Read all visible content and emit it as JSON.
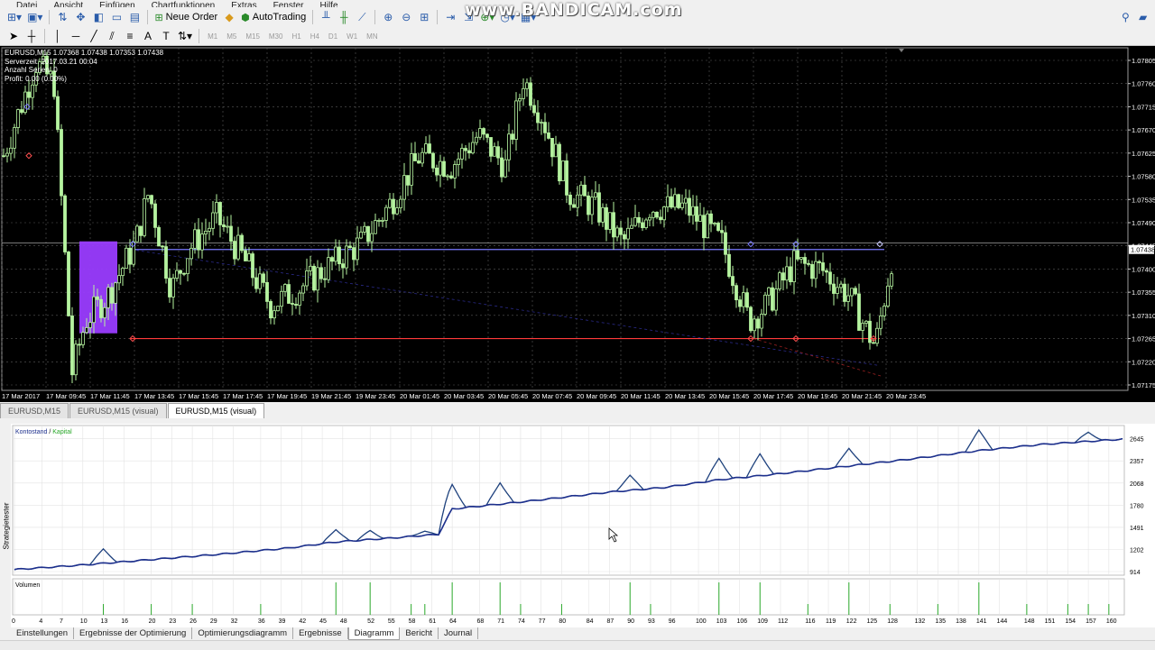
{
  "menu": [
    "Datei",
    "Ansicht",
    "Einfügen",
    "Chartfunktionen",
    "Extras",
    "Fenster",
    "Hilfe"
  ],
  "toolbar": {
    "new_order": "Neue Order",
    "autotrading": "AutoTrading"
  },
  "timeframes": [
    "M1",
    "M5",
    "M15",
    "M30",
    "H1",
    "H4",
    "D1",
    "W1",
    "MN"
  ],
  "watermark": "www.BANDICAM.com",
  "chart": {
    "symbol_line": "EURUSD,M15  1.07368 1.07438 1.07353 1.07438",
    "info_lines": [
      "Serverzeit: 2017.03.21 00:04",
      "Anzahl Serien: 0",
      "Profit: 0.00 (0.00%)"
    ],
    "price_labels": [
      "1.07805",
      "1.07760",
      "1.07715",
      "1.07670",
      "1.07625",
      "1.07580",
      "1.07535",
      "1.07490",
      "1.07445",
      "1.07400",
      "1.07355",
      "1.07310",
      "1.07265",
      "1.07220",
      "1.07175"
    ],
    "current_price": "1.07438",
    "time_labels": [
      "17 Mar 2017",
      "17 Mar 09:45",
      "17 Mar 11:45",
      "17 Mar 13:45",
      "17 Mar 15:45",
      "17 Mar 17:45",
      "17 Mar 19:45",
      "19 Mar 21:45",
      "19 Mar 23:45",
      "20 Mar 01:45",
      "20 Mar 03:45",
      "20 Mar 05:45",
      "20 Mar 07:45",
      "20 Mar 09:45",
      "20 Mar 11:45",
      "20 Mar 13:45",
      "20 Mar 15:45",
      "20 Mar 17:45",
      "20 Mar 19:45",
      "20 Mar 21:45",
      "20 Mar 23:45"
    ],
    "colors": {
      "bg": "#000000",
      "candle": "#b6f4a0",
      "grid": "#5a5a5a",
      "blue_line": "#7a7aff",
      "red_line": "#ff3a3a",
      "box": "#9a3cff"
    }
  },
  "chart_tabs": [
    "EURUSD,M15",
    "EURUSD,M15 (visual)",
    "EURUSD,M15 (visual)"
  ],
  "active_chart_tab": 2,
  "tester": {
    "legend_balance": "Kontostand",
    "legend_sep": " / ",
    "legend_equity": "Kapital",
    "y_labels": [
      "2645",
      "2357",
      "2068",
      "1780",
      "1491",
      "1202",
      "914"
    ],
    "volume_label": "Volumen",
    "x_labels": [
      "0",
      "4",
      "7",
      "10",
      "13",
      "16",
      "20",
      "23",
      "26",
      "29",
      "32",
      "36",
      "39",
      "42",
      "45",
      "48",
      "52",
      "55",
      "58",
      "61",
      "64",
      "68",
      "71",
      "74",
      "77",
      "80",
      "84",
      "87",
      "90",
      "93",
      "96",
      "100",
      "103",
      "106",
      "109",
      "112",
      "116",
      "119",
      "122",
      "125",
      "128",
      "132",
      "135",
      "138",
      "141",
      "144",
      "148",
      "151",
      "154",
      "157",
      "160"
    ],
    "side_label": "Strategietester",
    "colors": {
      "balance": "#1c2f8c",
      "equity": "#2aa82a",
      "volume": "#2aa82a",
      "grid": "#e3e3e3"
    }
  },
  "tester_chart_data": {
    "type": "line",
    "x_range": [
      0,
      162
    ],
    "ylim": [
      914,
      2700
    ],
    "balance": [
      [
        0,
        940
      ],
      [
        10,
        1000
      ],
      [
        20,
        1070
      ],
      [
        30,
        1140
      ],
      [
        40,
        1220
      ],
      [
        47,
        1300
      ],
      [
        55,
        1350
      ],
      [
        62,
        1400
      ],
      [
        64,
        1730
      ],
      [
        75,
        1830
      ],
      [
        87,
        1950
      ],
      [
        95,
        2010
      ],
      [
        103,
        2110
      ],
      [
        112,
        2190
      ],
      [
        122,
        2290
      ],
      [
        130,
        2370
      ],
      [
        141,
        2490
      ],
      [
        150,
        2570
      ],
      [
        162,
        2640
      ]
    ],
    "equity_spikes": [
      [
        13,
        1210
      ],
      [
        47,
        1460
      ],
      [
        52,
        1450
      ],
      [
        60,
        1440
      ],
      [
        64,
        2050
      ],
      [
        71,
        2070
      ],
      [
        90,
        2170
      ],
      [
        103,
        2390
      ],
      [
        109,
        2450
      ],
      [
        122,
        2520
      ],
      [
        141,
        2760
      ],
      [
        157,
        2730
      ]
    ],
    "volume_at": [
      13,
      20,
      26,
      36,
      47,
      52,
      58,
      60,
      64,
      71,
      74,
      80,
      90,
      93,
      103,
      109,
      116,
      122,
      128,
      135,
      141,
      148,
      154,
      157,
      160
    ],
    "volume_big_at": [
      47,
      52,
      64,
      71,
      90,
      103,
      109,
      122,
      141
    ]
  },
  "bottom_tabs": [
    "Einstellungen",
    "Ergebnisse der Optimierung",
    "Optimierungsdiagramm",
    "Ergebnisse",
    "Diagramm",
    "Bericht",
    "Journal"
  ],
  "active_bottom_tab": 4
}
